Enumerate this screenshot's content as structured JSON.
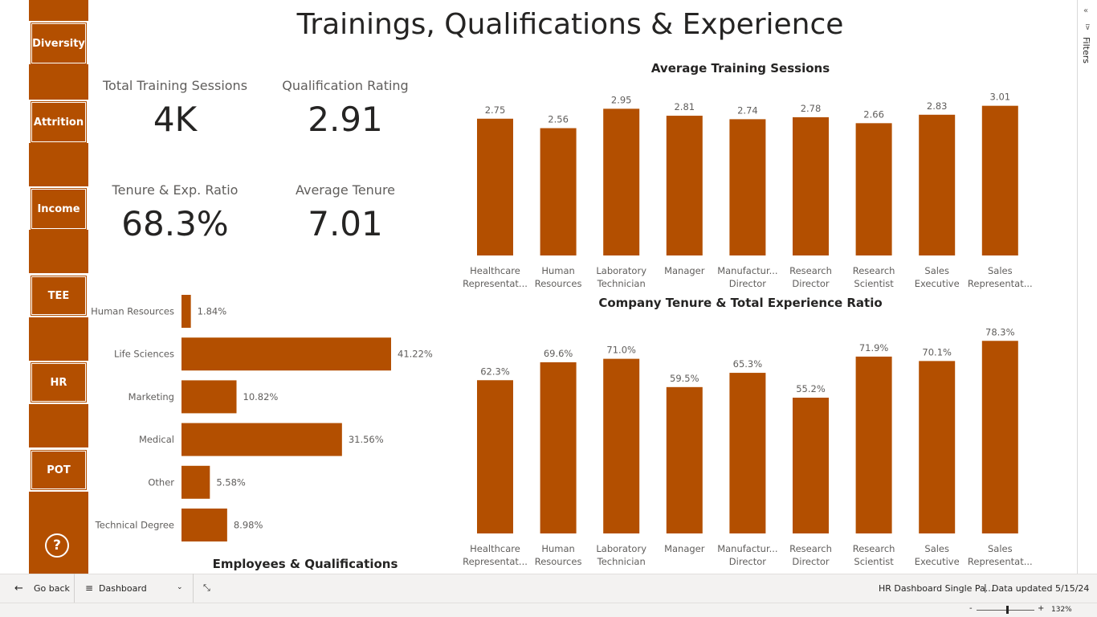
{
  "nav": {
    "buttons": [
      {
        "label": "Diversity"
      },
      {
        "label": "Attrition"
      },
      {
        "label": "Income"
      },
      {
        "label": "TEE"
      },
      {
        "label": "HR"
      },
      {
        "label": "POT"
      }
    ],
    "help_icon": "question-circle-icon"
  },
  "page": {
    "title": "Trainings, Qualifications & Experience"
  },
  "kpis": {
    "total_training_sessions": {
      "label": "Total Training Sessions",
      "value": "4K"
    },
    "qualification_rating": {
      "label": "Qualification Rating",
      "value": "2.91"
    },
    "tenure_exp_ratio": {
      "label": "Tenure & Exp. Ratio",
      "value": "68.3%"
    },
    "average_tenure": {
      "label": "Average Tenure",
      "value": "7.01"
    }
  },
  "chart_data": [
    {
      "type": "bar",
      "orientation": "vertical",
      "title": "Average Training Sessions",
      "categories": [
        "Healthcare Representat...",
        "Human Resources",
        "Laboratory Technician",
        "Manager",
        "Manufactur... Director",
        "Research Director",
        "Research Scientist",
        "Sales Executive",
        "Sales Representat..."
      ],
      "values": [
        2.75,
        2.56,
        2.95,
        2.81,
        2.74,
        2.78,
        2.66,
        2.83,
        3.01
      ],
      "value_labels": [
        "2.75",
        "2.56",
        "2.95",
        "2.81",
        "2.74",
        "2.78",
        "2.66",
        "2.83",
        "3.01"
      ],
      "ylim": [
        0,
        3.15
      ],
      "color": "#b34f00"
    },
    {
      "type": "bar",
      "orientation": "vertical",
      "title": "Company Tenure & Total Experience Ratio",
      "categories": [
        "Healthcare Representat...",
        "Human Resources",
        "Laboratory Technician",
        "Manager",
        "Manufactur... Director",
        "Research Director",
        "Research Scientist",
        "Sales Executive",
        "Sales Representat..."
      ],
      "values": [
        62.3,
        69.6,
        71.0,
        59.5,
        65.3,
        55.2,
        71.9,
        70.1,
        78.3
      ],
      "value_labels": [
        "62.3%",
        "69.6%",
        "71.0%",
        "59.5%",
        "65.3%",
        "55.2%",
        "71.9%",
        "70.1%",
        "78.3%"
      ],
      "ylim": [
        0,
        81.0
      ],
      "color": "#b34f00"
    },
    {
      "type": "bar",
      "orientation": "horizontal",
      "title": "Employees & Qualifications",
      "categories": [
        "Human Resources",
        "Life Sciences",
        "Marketing",
        "Medical",
        "Other",
        "Technical Degree"
      ],
      "values": [
        1.84,
        41.22,
        10.82,
        31.56,
        5.58,
        8.98
      ],
      "value_labels": [
        "1.84%",
        "41.22%",
        "10.82%",
        "31.56%",
        "5.58%",
        "8.98%"
      ],
      "xlim": [
        0,
        41.22
      ],
      "color": "#b34f00"
    }
  ],
  "bottom_bar": {
    "back_label": "Go back",
    "page_select": "Dashboard",
    "report_name": "HR Dashboard Single Pa...",
    "data_updated": "Data updated 5/15/24",
    "zoom": "132%",
    "zoom_minus": "-",
    "zoom_plus": "+"
  },
  "filters_pane": {
    "label": "Filters"
  }
}
